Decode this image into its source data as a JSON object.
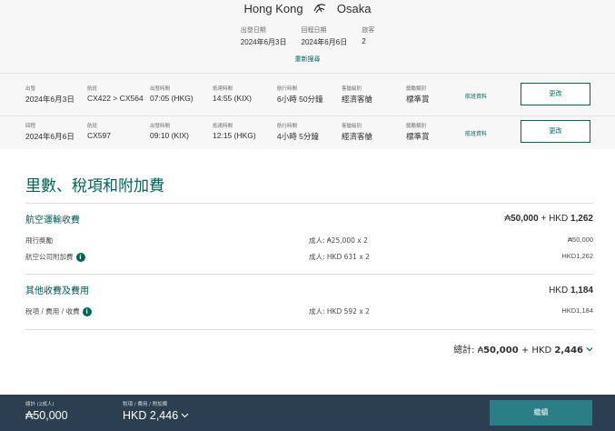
{
  "route": {
    "origin": "Hong Kong",
    "destination": "Osaka"
  },
  "trip_meta": [
    {
      "label": "出發日期",
      "value": "2024年6月3日"
    },
    {
      "label": "回程日期",
      "value": "2024年6月6日"
    },
    {
      "label": "旅客",
      "value": "2"
    }
  ],
  "research_label": "重新搜尋",
  "flights": [
    {
      "dir_label": "出發",
      "date": "2024年6月3日",
      "flight_label": "航班",
      "flight": "CX422 > CX564",
      "dep_label": "出發時間",
      "dep": "07:05 (HKG)",
      "arr_label": "抵達時間",
      "arr": "14:55 (KIX)",
      "dur_label": "航行時間",
      "dur": "6小時 50分鐘",
      "cabin_label": "客艙級別",
      "cabin": "經濟客艙",
      "award_label": "獎勵類別",
      "award": "標準賞",
      "info_link": "航班資料",
      "change_label": "更改"
    },
    {
      "dir_label": "回程",
      "date": "2024年6月6日",
      "flight_label": "航班",
      "flight": "CX597",
      "dep_label": "出發時間",
      "dep": "09:10 (KIX)",
      "arr_label": "抵達時間",
      "arr": "12:15 (HKG)",
      "dur_label": "航行時間",
      "dur": "4小時 5分鐘",
      "cabin_label": "客艙級別",
      "cabin": "經濟客艙",
      "award_label": "獎勵類別",
      "award": "標準賞",
      "info_link": "航班資料",
      "change_label": "更改"
    }
  ],
  "summary": {
    "title": "里數、稅項和附加費",
    "air": {
      "title": "航空運輸收費",
      "total_miles": "50,000",
      "total_plus": " + HKD ",
      "total_hkd": "1,262",
      "items": [
        {
          "label": "飛行獎勵",
          "qty": "成人: ₳25,000 x 2",
          "amount": "₳50,000"
        },
        {
          "label": "航空公司附加費",
          "qty": "成人: HKD 631 x 2",
          "amount": "HKD1,262"
        }
      ]
    },
    "other": {
      "title": "其他收費及費用",
      "total_prefix": "HKD ",
      "total_hkd": "1,184",
      "items": [
        {
          "label": "稅項 / 費用 / 收費",
          "qty": "成人: HKD 592 x 2",
          "amount": "HKD1,184"
        }
      ]
    },
    "grand": {
      "label": "總計:",
      "miles": "50,000",
      "plus": " + HKD ",
      "hkd": "2,446"
    }
  },
  "bottom_bar": {
    "total_label": "總計 (2成人)",
    "total_value": "₳50,000",
    "tax_label": "稅項 / 費用 / 附加費",
    "tax_value": "HKD 2,446",
    "continue_label": "繼續"
  },
  "colors": {
    "brand": "#00645a",
    "bar": "#2c3f50",
    "button": "#2a7f86"
  }
}
